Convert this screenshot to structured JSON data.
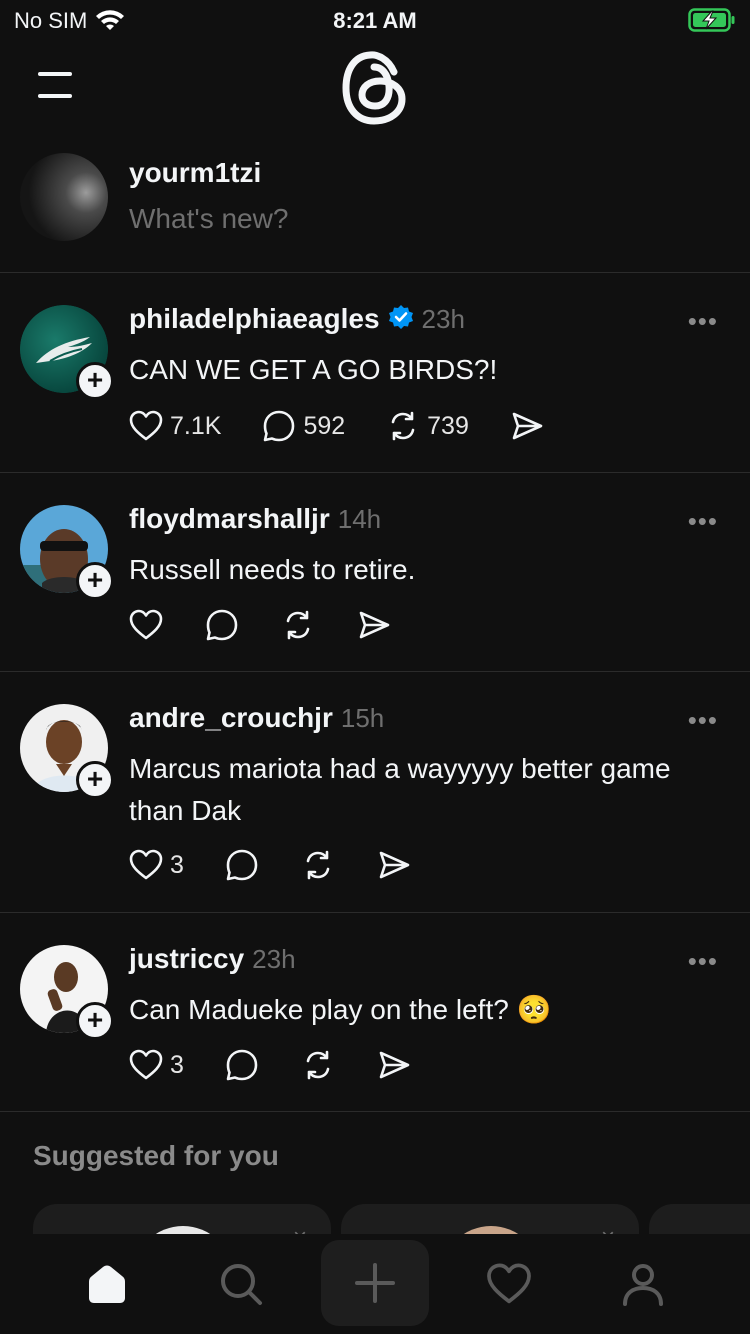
{
  "status_bar": {
    "carrier": "No SIM",
    "time": "8:21 AM",
    "battery_color": "#34c759"
  },
  "header": {
    "menu_icon": "hamburger-icon",
    "logo_icon": "threads-logo"
  },
  "composer": {
    "username": "yourm1tzi",
    "placeholder": "What's new?"
  },
  "posts": [
    {
      "author": "philadelphiaeagles",
      "verified": true,
      "time": "23h",
      "text": "CAN WE GET A GO BIRDS?!",
      "likes": "7.1K",
      "replies": "592",
      "reposts": "739"
    },
    {
      "author": "floydmarshalljr",
      "verified": false,
      "time": "14h",
      "text": "Russell needs to retire.",
      "likes": "",
      "replies": "",
      "reposts": ""
    },
    {
      "author": "andre_crouchjr",
      "verified": false,
      "time": "15h",
      "text": "Marcus mariota had a wayyyyy better game than Dak",
      "likes": "3",
      "replies": "",
      "reposts": ""
    },
    {
      "author": "justriccy",
      "verified": false,
      "time": "23h",
      "text": "Can Madueke play on the left? 🥺",
      "likes": "3",
      "replies": "",
      "reposts": ""
    }
  ],
  "more_label": "•••",
  "follow_label": "+",
  "suggested": {
    "title": "Suggested for you",
    "dismiss_label": "×"
  },
  "tab_bar": {
    "items": [
      "home-icon",
      "search-icon",
      "compose-icon",
      "activity-heart-icon",
      "profile-icon"
    ],
    "active": "home-icon"
  }
}
